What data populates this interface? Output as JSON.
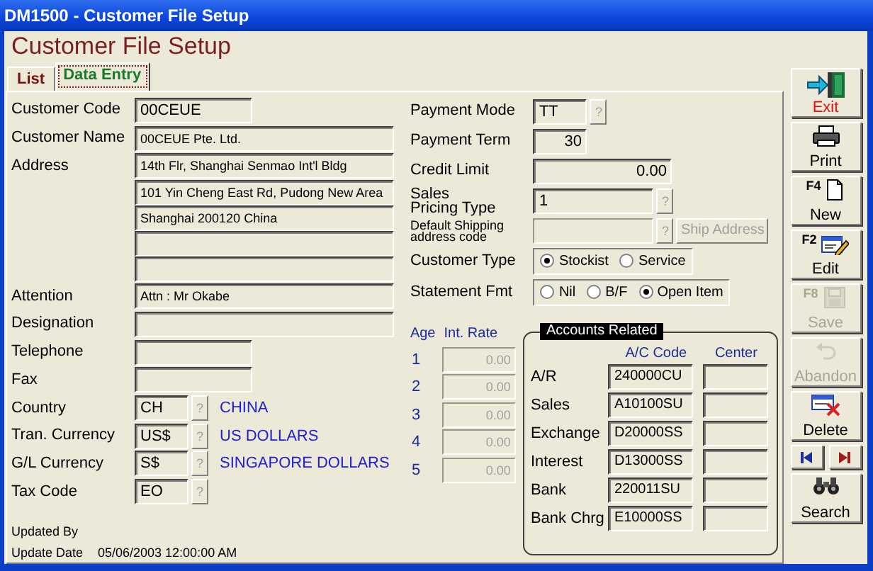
{
  "window": {
    "title": "DM1500 - Customer File Setup"
  },
  "heading": "Customer File Setup",
  "tabs": [
    {
      "label": "List",
      "selected": false
    },
    {
      "label": "Data Entry",
      "selected": true
    }
  ],
  "customer_fields": [
    {
      "kind": "short",
      "label": "Customer Code",
      "value": "00CEUE"
    },
    {
      "kind": "wide",
      "label": "Customer Name",
      "value": "00CEUE Pte. Ltd."
    },
    {
      "kind": "wide",
      "label": "Address",
      "value": "14th Flr, Shanghai Senmao Int'l Bldg"
    },
    {
      "kind": "line",
      "value": "101  Yin Cheng East Rd, Pudong New Area"
    },
    {
      "kind": "line",
      "value": "Shanghai 200120 China"
    },
    {
      "kind": "line"
    },
    {
      "kind": "line"
    },
    {
      "kind": "wide",
      "label": "Attention",
      "value": "Attn : Mr Okabe"
    },
    {
      "kind": "wide",
      "label": "Designation"
    },
    {
      "kind": "short",
      "label": "Telephone"
    },
    {
      "kind": "short",
      "label": "Fax"
    },
    {
      "kind": "lookup",
      "label": "Country",
      "value": "CH",
      "button": "?",
      "description": "CHINA"
    },
    {
      "kind": "lookup",
      "label": "Tran. Currency",
      "value": "US$",
      "button": "?",
      "description": "US DOLLARS"
    },
    {
      "kind": "lookup",
      "label": "G/L Currency",
      "value": "S$",
      "button": "?",
      "description": "SINGAPORE DOLLARS"
    },
    {
      "kind": "lookup",
      "label": "Tax Code",
      "value": "EO",
      "button": "?"
    }
  ],
  "audit": {
    "updated_by_label": "Updated By",
    "update_date_label": "Update Date",
    "update_date": "05/06/2003 12:00:00 AM"
  },
  "terms_fields": [
    {
      "kind": "code",
      "label": "Payment Mode",
      "value": "TT",
      "button": "?",
      "disabled": false
    },
    {
      "kind": "count",
      "label": "Payment Term",
      "value": "30",
      "disabled": false
    },
    {
      "kind": "amount",
      "label": "Credit Limit",
      "value": "0.00",
      "disabled": false
    },
    {
      "kind": "pick",
      "label": "Sales\nPricing Type",
      "value": "1",
      "button": "?",
      "disabled": false
    },
    {
      "kind": "ship",
      "label": "Default Shipping\naddress code",
      "button": "?",
      "action": "Ship Address",
      "disabled": true
    },
    {
      "kind": "radios",
      "label": "Customer Type",
      "options": [
        {
          "label": "Stockist",
          "selected": true
        },
        {
          "label": "Service",
          "selected": false
        }
      ]
    },
    {
      "kind": "radios",
      "label": "Statement Fmt",
      "options": [
        {
          "label": "Nil",
          "selected": false
        },
        {
          "label": "B/F",
          "selected": false
        },
        {
          "label": "Open Item",
          "selected": true
        }
      ]
    }
  ],
  "interest": {
    "columns": [
      "Age",
      "Int. Rate"
    ],
    "rows": [
      {
        "age": "1",
        "rate": "0.00",
        "disabled": true
      },
      {
        "age": "2",
        "rate": "0.00",
        "disabled": true
      },
      {
        "age": "3",
        "rate": "0.00",
        "disabled": true
      },
      {
        "age": "4",
        "rate": "0.00",
        "disabled": true
      },
      {
        "age": "5",
        "rate": "0.00",
        "disabled": true
      }
    ]
  },
  "accounts": {
    "title": "Accounts Related",
    "columns": [
      "A/C Code",
      "Center"
    ],
    "rows": [
      {
        "label": "A/R",
        "code": "240000CU"
      },
      {
        "label": "Sales",
        "code": "A10100SU"
      },
      {
        "label": "Exchange",
        "code": "D20000SS"
      },
      {
        "label": "Interest",
        "code": "D13000SS"
      },
      {
        "label": "Bank",
        "code": "220011SU"
      },
      {
        "label": "Bank Chrg",
        "code": "E10000SS"
      }
    ]
  },
  "toolbar": [
    {
      "kind": "exit",
      "label": "Exit",
      "disabled": false
    },
    {
      "kind": "print",
      "label": "Print",
      "disabled": false
    },
    {
      "kind": "new",
      "hotkey": "F4",
      "label": "New",
      "disabled": false
    },
    {
      "kind": "edit",
      "hotkey": "F2",
      "label": "Edit",
      "disabled": false
    },
    {
      "kind": "save",
      "hotkey": "F8",
      "label": "Save",
      "disabled": true
    },
    {
      "kind": "abandon",
      "label": "Abandon",
      "disabled": true
    },
    {
      "kind": "delete",
      "label": "Delete",
      "disabled": false
    },
    {
      "kind": "first",
      "disabled": false
    },
    {
      "kind": "last",
      "disabled": false
    },
    {
      "kind": "search",
      "label": "Search",
      "disabled": false
    }
  ]
}
